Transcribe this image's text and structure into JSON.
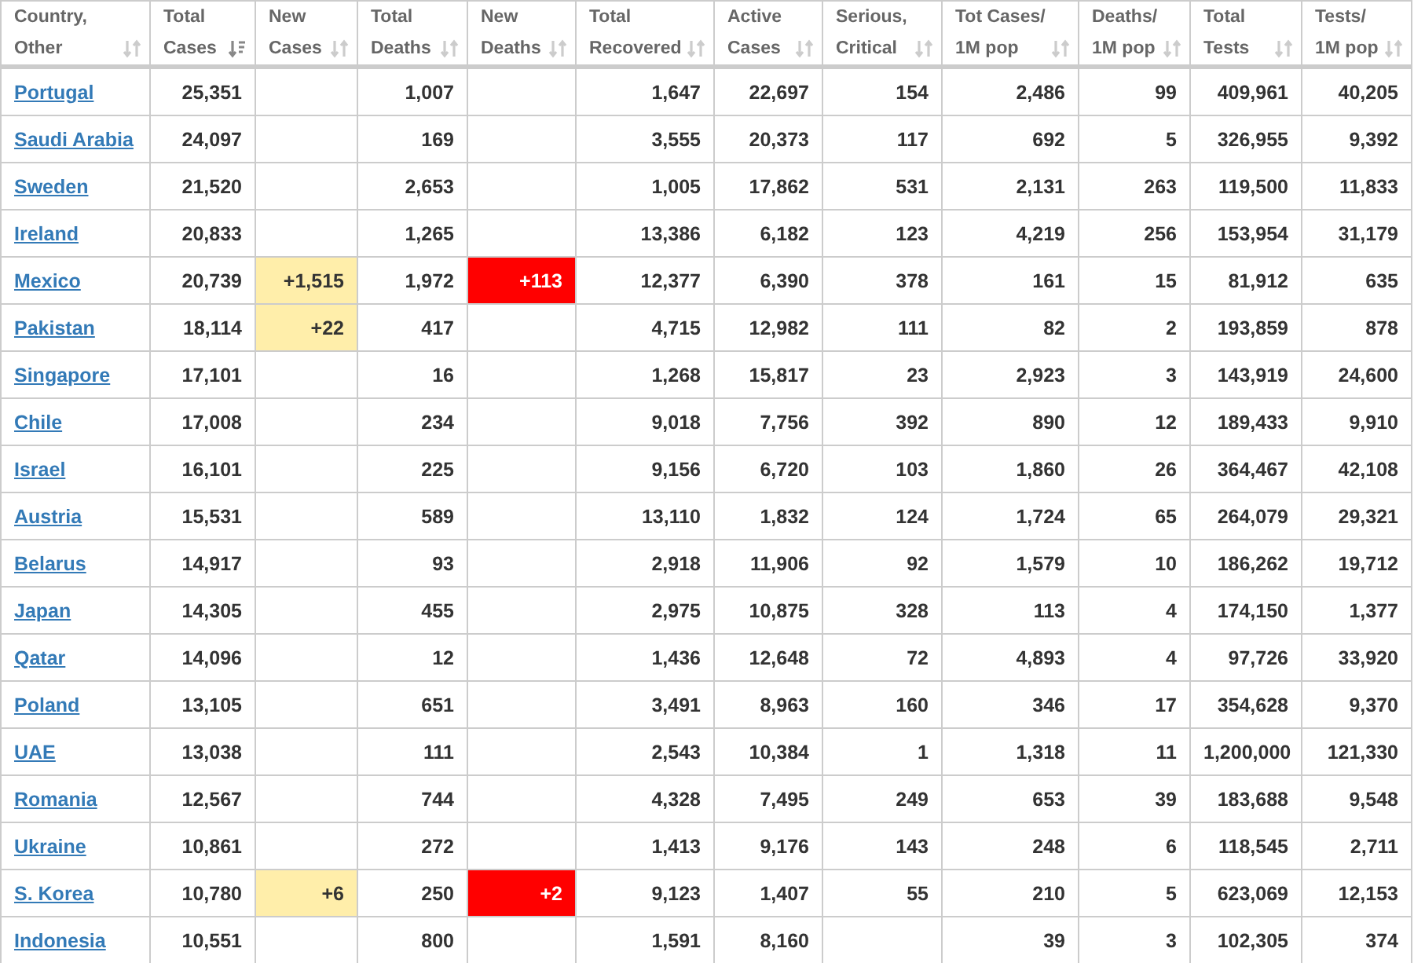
{
  "table": {
    "columns": [
      {
        "label": "Country,\nOther",
        "sorted": false,
        "kind": "name"
      },
      {
        "label": "Total\nCases",
        "sorted": true,
        "kind": "number"
      },
      {
        "label": "New\nCases",
        "sorted": false,
        "kind": "new_cases"
      },
      {
        "label": "Total\nDeaths",
        "sorted": false,
        "kind": "number"
      },
      {
        "label": "New\nDeaths",
        "sorted": false,
        "kind": "new_deaths"
      },
      {
        "label": "Total\nRecovered",
        "sorted": false,
        "kind": "number"
      },
      {
        "label": "Active\nCases",
        "sorted": false,
        "kind": "number"
      },
      {
        "label": "Serious,\nCritical",
        "sorted": false,
        "kind": "number"
      },
      {
        "label": "Tot Cases/\n1M pop",
        "sorted": false,
        "kind": "number"
      },
      {
        "label": "Deaths/\n1M pop",
        "sorted": false,
        "kind": "number"
      },
      {
        "label": "Total\nTests",
        "sorted": false,
        "kind": "number"
      },
      {
        "label": "Tests/\n1M pop",
        "sorted": false,
        "kind": "number"
      }
    ],
    "rows": [
      {
        "cells": [
          "Portugal",
          "25,351",
          null,
          "1,007",
          null,
          "1,647",
          "22,697",
          "154",
          "2,486",
          "99",
          "409,961",
          "40,205"
        ]
      },
      {
        "cells": [
          "Saudi Arabia",
          "24,097",
          null,
          "169",
          null,
          "3,555",
          "20,373",
          "117",
          "692",
          "5",
          "326,955",
          "9,392"
        ]
      },
      {
        "cells": [
          "Sweden",
          "21,520",
          null,
          "2,653",
          null,
          "1,005",
          "17,862",
          "531",
          "2,131",
          "263",
          "119,500",
          "11,833"
        ]
      },
      {
        "cells": [
          "Ireland",
          "20,833",
          null,
          "1,265",
          null,
          "13,386",
          "6,182",
          "123",
          "4,219",
          "256",
          "153,954",
          "31,179"
        ]
      },
      {
        "cells": [
          "Mexico",
          "20,739",
          "+1,515",
          "1,972",
          "+113",
          "12,377",
          "6,390",
          "378",
          "161",
          "15",
          "81,912",
          "635"
        ]
      },
      {
        "cells": [
          "Pakistan",
          "18,114",
          "+22",
          "417",
          null,
          "4,715",
          "12,982",
          "111",
          "82",
          "2",
          "193,859",
          "878"
        ]
      },
      {
        "cells": [
          "Singapore",
          "17,101",
          null,
          "16",
          null,
          "1,268",
          "15,817",
          "23",
          "2,923",
          "3",
          "143,919",
          "24,600"
        ]
      },
      {
        "cells": [
          "Chile",
          "17,008",
          null,
          "234",
          null,
          "9,018",
          "7,756",
          "392",
          "890",
          "12",
          "189,433",
          "9,910"
        ]
      },
      {
        "cells": [
          "Israel",
          "16,101",
          null,
          "225",
          null,
          "9,156",
          "6,720",
          "103",
          "1,860",
          "26",
          "364,467",
          "42,108"
        ]
      },
      {
        "cells": [
          "Austria",
          "15,531",
          null,
          "589",
          null,
          "13,110",
          "1,832",
          "124",
          "1,724",
          "65",
          "264,079",
          "29,321"
        ]
      },
      {
        "cells": [
          "Belarus",
          "14,917",
          null,
          "93",
          null,
          "2,918",
          "11,906",
          "92",
          "1,579",
          "10",
          "186,262",
          "19,712"
        ]
      },
      {
        "cells": [
          "Japan",
          "14,305",
          null,
          "455",
          null,
          "2,975",
          "10,875",
          "328",
          "113",
          "4",
          "174,150",
          "1,377"
        ]
      },
      {
        "cells": [
          "Qatar",
          "14,096",
          null,
          "12",
          null,
          "1,436",
          "12,648",
          "72",
          "4,893",
          "4",
          "97,726",
          "33,920"
        ]
      },
      {
        "cells": [
          "Poland",
          "13,105",
          null,
          "651",
          null,
          "3,491",
          "8,963",
          "160",
          "346",
          "17",
          "354,628",
          "9,370"
        ]
      },
      {
        "cells": [
          "UAE",
          "13,038",
          null,
          "111",
          null,
          "2,543",
          "10,384",
          "1",
          "1,318",
          "11",
          "1,200,000",
          "121,330"
        ]
      },
      {
        "cells": [
          "Romania",
          "12,567",
          null,
          "744",
          null,
          "4,328",
          "7,495",
          "249",
          "653",
          "39",
          "183,688",
          "9,548"
        ]
      },
      {
        "cells": [
          "Ukraine",
          "10,861",
          null,
          "272",
          null,
          "1,413",
          "9,176",
          "143",
          "248",
          "6",
          "118,545",
          "2,711"
        ]
      },
      {
        "cells": [
          "S. Korea",
          "10,780",
          "+6",
          "250",
          "+2",
          "9,123",
          "1,407",
          "55",
          "210",
          "5",
          "623,069",
          "12,153"
        ]
      },
      {
        "cells": [
          "Indonesia",
          "10,551",
          null,
          "800",
          null,
          "1,591",
          "8,160",
          null,
          "39",
          "3",
          "102,305",
          "374"
        ]
      }
    ]
  }
}
